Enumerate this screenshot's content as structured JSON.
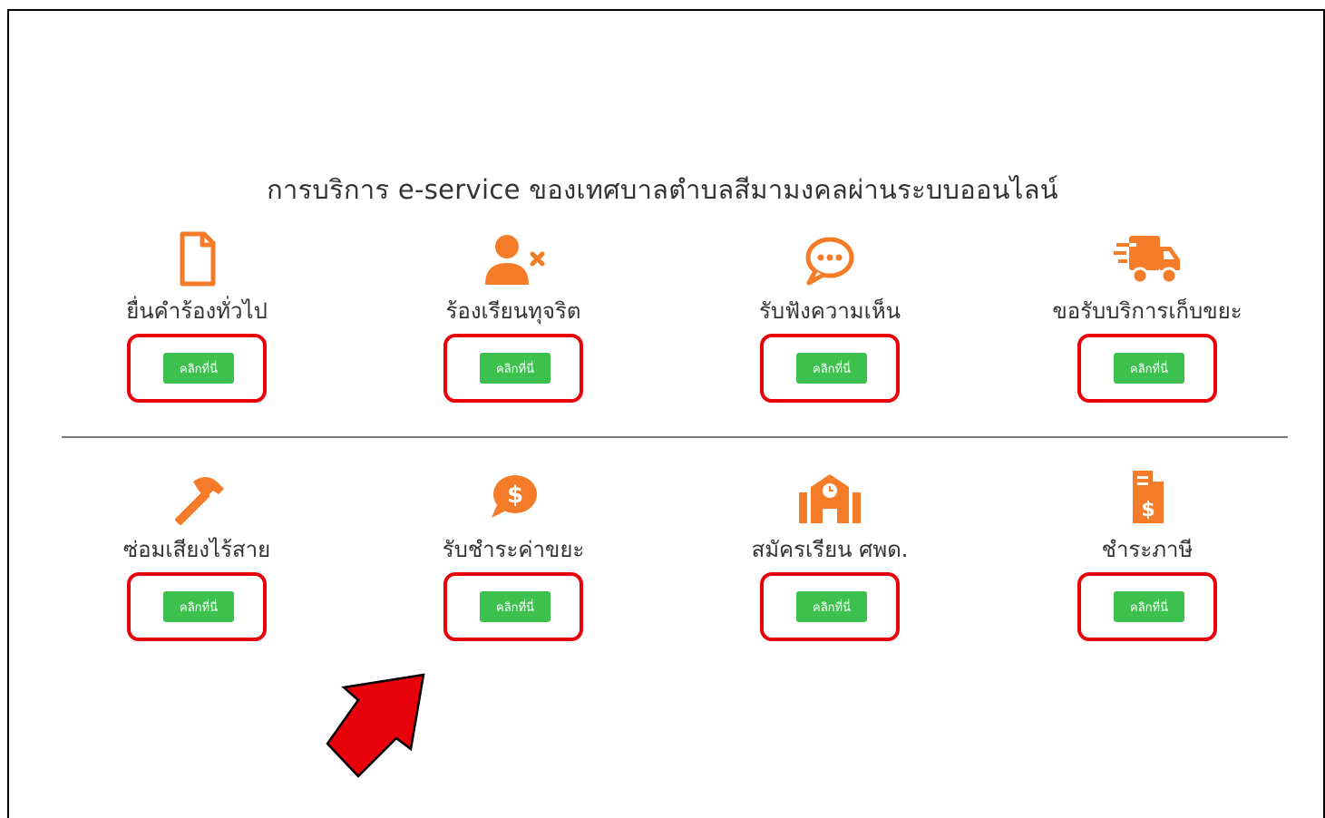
{
  "page": {
    "title": "การบริการ e-service ของเทศบาลตำบลสีมามงคลผ่านระบบออนไลน์"
  },
  "colors": {
    "icon": "#f47c28",
    "button": "#3cc04e",
    "highlight_box": "#e8000b",
    "arrow": "#e8000b"
  },
  "services": [
    {
      "label": "ยื่นคำร้องทั่วไป",
      "button": "คลิกที่นี่",
      "icon": "file-icon"
    },
    {
      "label": "ร้องเรียนทุจริต",
      "button": "คลิกที่นี่",
      "icon": "user-times-icon"
    },
    {
      "label": "รับฟังความเห็น",
      "button": "คลิกที่นี่",
      "icon": "comment-icon"
    },
    {
      "label": "ขอรับบริการเก็บขยะ",
      "button": "คลิกที่นี่",
      "icon": "truck-icon"
    },
    {
      "label": "ซ่อมเสียงไร้สาย",
      "button": "คลิกที่นี่",
      "icon": "hammer-icon"
    },
    {
      "label": "รับชำระค่าขยะ",
      "button": "คลิกที่นี่",
      "icon": "money-comment-icon"
    },
    {
      "label": "สมัครเรียน ศพด.",
      "button": "คลิกที่นี่",
      "icon": "school-icon"
    },
    {
      "label": "ชำระภาษี",
      "button": "คลิกที่นี่",
      "icon": "invoice-dollar-icon"
    }
  ]
}
